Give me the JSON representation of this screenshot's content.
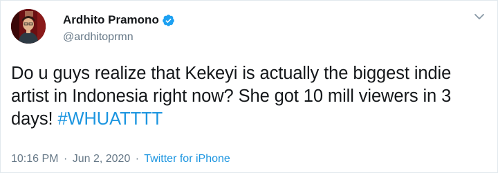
{
  "tweet": {
    "author": {
      "display_name": "Ardhito Pramono",
      "handle": "@ardhitoprmn",
      "verified_icon": "verified-badge-icon",
      "avatar_icon": "avatar-photo"
    },
    "text_plain": "Do u guys realize that Kekeyi is actually the biggest indie artist in Indonesia right now? She got 10 mill viewers in 3 days! ",
    "hashtag": "#WHUATTTT",
    "time": "10:16 PM",
    "separator": "·",
    "date": "Jun 2, 2020",
    "source": "Twitter for iPhone",
    "menu_icon": "chevron-down-icon"
  },
  "colors": {
    "text": "#14171a",
    "secondary": "#657786",
    "link": "#1b95e0",
    "verified": "#1da1f2",
    "border": "#e1e8ed"
  }
}
